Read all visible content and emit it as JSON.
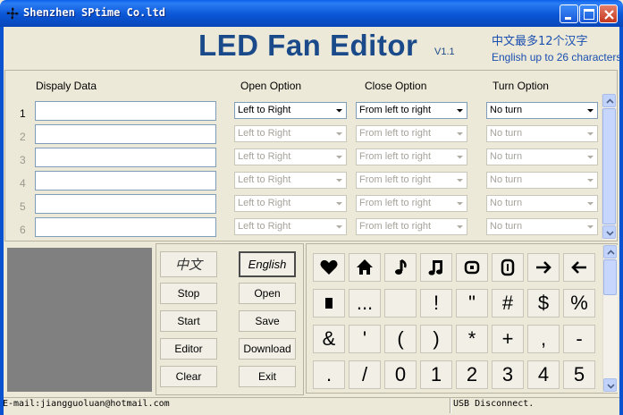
{
  "window": {
    "title": "Shenzhen SPtime Co.ltd",
    "buttons": [
      "minimize",
      "maximize",
      "close"
    ]
  },
  "header": {
    "app_title": "LED Fan Editor",
    "version": "V1.1",
    "hint_cn": "中文最多12个汉字",
    "hint_en": "English up to 26 characters"
  },
  "columns": {
    "display": "Dispaly Data",
    "open": "Open Option",
    "close": "Close Option",
    "turn": "Turn Option"
  },
  "rows": [
    {
      "num": "1",
      "open": "Left to Right",
      "close": "From left to right",
      "turn": "No turn"
    },
    {
      "num": "2",
      "open": "Left to Right",
      "close": "From left to right",
      "turn": "No turn"
    },
    {
      "num": "3",
      "open": "Left to Right",
      "close": "From left to right",
      "turn": "No turn"
    },
    {
      "num": "4",
      "open": "Left to Right",
      "close": "From left to right",
      "turn": "No turn"
    },
    {
      "num": "5",
      "open": "Left to Right",
      "close": "From left to right",
      "turn": "No turn"
    },
    {
      "num": "6",
      "open": "Left to Right",
      "close": "From left to right",
      "turn": "No turn"
    }
  ],
  "buttons": {
    "chinese": "中文",
    "english": "English",
    "stop": "Stop",
    "open": "Open",
    "start": "Start",
    "save": "Save",
    "editor": "Editor",
    "download": "Download",
    "clear": "Clear",
    "exit": "Exit"
  },
  "symbols": {
    "row1_icons": [
      "heart-icon",
      "house-icon",
      "eighth-note-icon",
      "beamed-notes-icon",
      "target-icon",
      "zero-glyph-icon",
      "arrow-right-icon",
      "arrow-left-icon"
    ],
    "row2": [
      "",
      "...",
      "",
      "!",
      "\"",
      "#",
      "$",
      "%"
    ],
    "row3": [
      "&",
      "'",
      "(",
      ")",
      "*",
      "+",
      ",",
      "-"
    ],
    "row4": [
      ".",
      "/",
      "0",
      "1",
      "2",
      "3",
      "4",
      "5"
    ]
  },
  "status": {
    "email": "E-mail:jiangguoluan@hotmail.com",
    "usb": "USB Disconnect."
  }
}
